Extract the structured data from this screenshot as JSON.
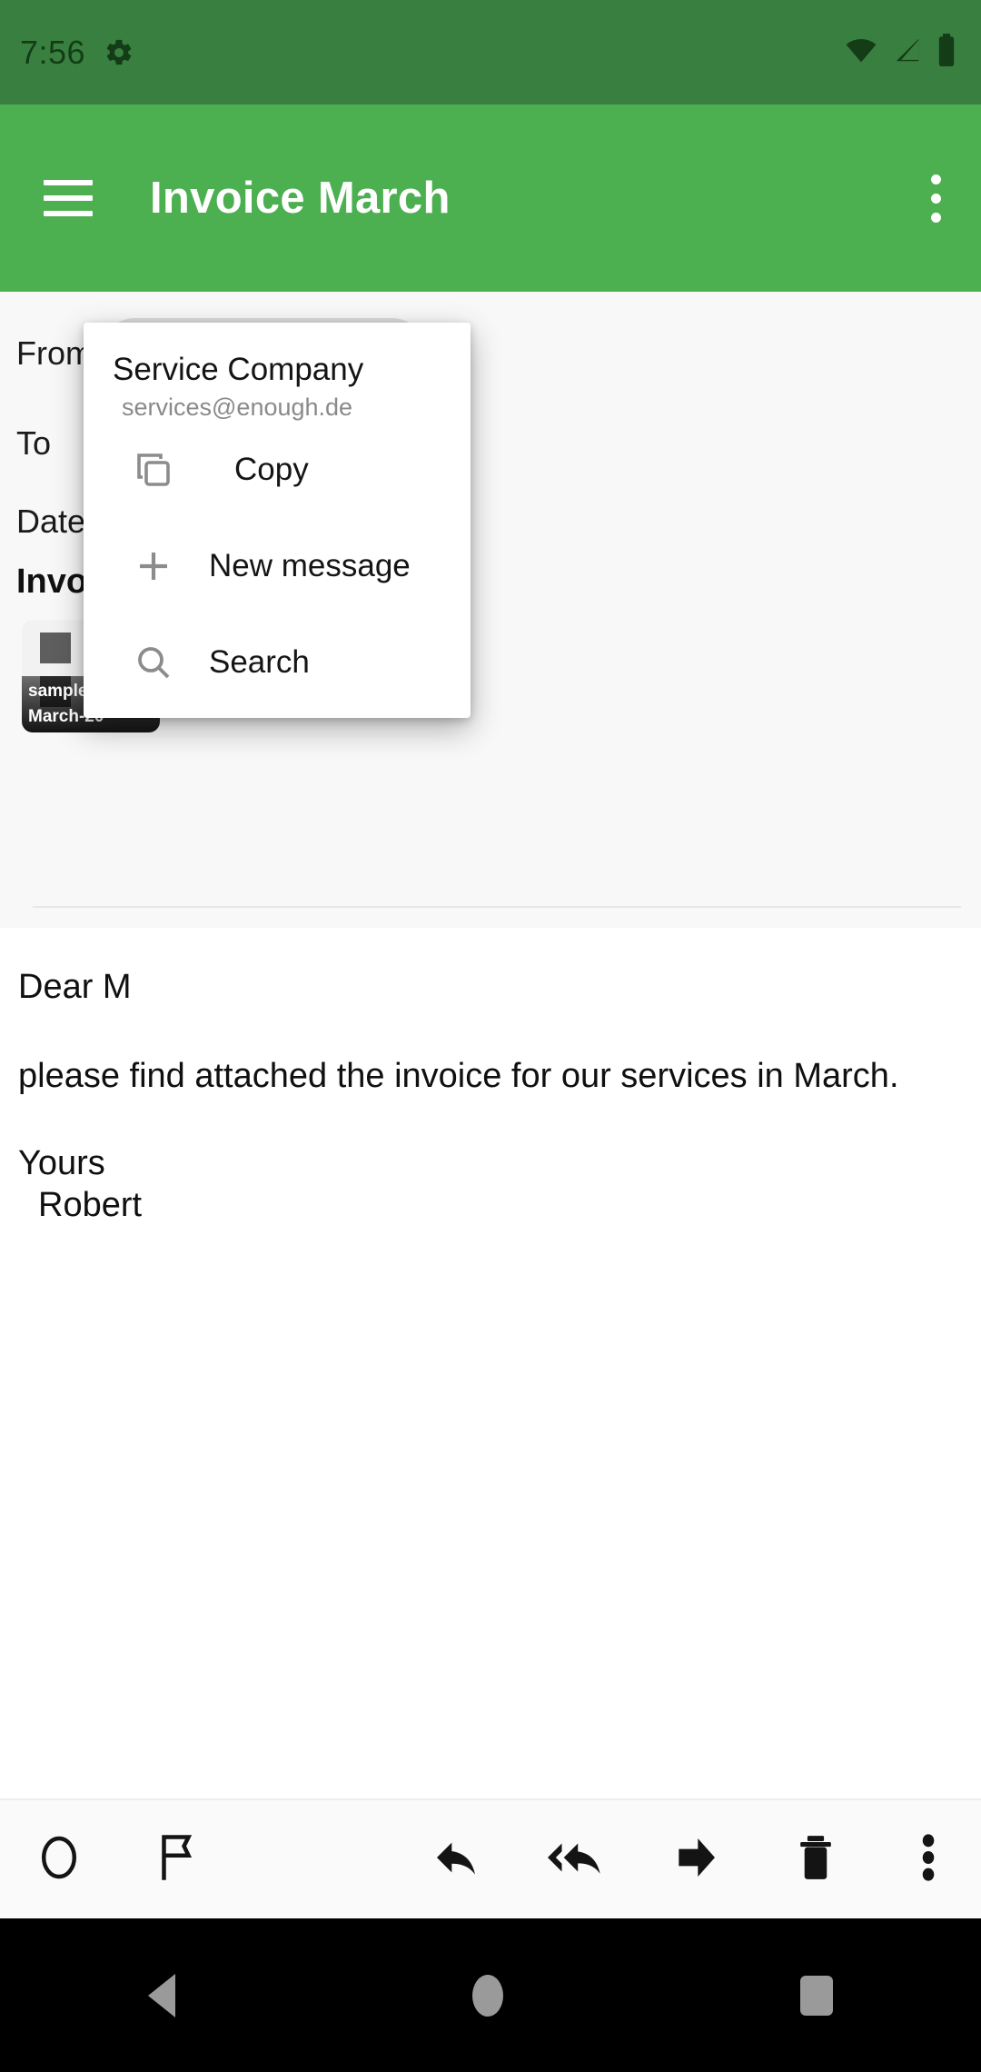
{
  "status_bar": {
    "time": "7:56",
    "icons": [
      "gear-icon",
      "wifi-icon",
      "signal-icon",
      "battery-icon"
    ],
    "background": "#398040"
  },
  "app_bar": {
    "title": "Invoice March",
    "menu_icon": "hamburger-icon",
    "overflow_icon": "overflow-menu-icon",
    "background": "#4caf50"
  },
  "message_headers": {
    "from_label": "From",
    "from_value": "Service Company",
    "to_label": "To",
    "to_value": "",
    "date_label": "Date",
    "date_value": "",
    "subject": "Invoice",
    "attachment": {
      "name_line1": "sample-in",
      "name_line2": "March-20"
    }
  },
  "body": {
    "greeting": "Dear M",
    "paragraph": "please find attached the invoice for our services in March.",
    "closing": "Yours",
    "signature": "Robert"
  },
  "popup": {
    "name": "Service Company",
    "email": "services@enough.de",
    "items": [
      {
        "label": "Copy",
        "icon": "copy-icon"
      },
      {
        "label": "New message",
        "icon": "plus-icon"
      },
      {
        "label": "Search",
        "icon": "search-icon"
      }
    ]
  },
  "toolbar": {
    "items": [
      {
        "name": "mark-unread-button",
        "icon": "circle-icon"
      },
      {
        "name": "flag-button",
        "icon": "flag-icon"
      },
      {
        "name": "reply-button",
        "icon": "reply-icon"
      },
      {
        "name": "reply-all-button",
        "icon": "reply-all-icon"
      },
      {
        "name": "forward-button",
        "icon": "forward-icon"
      },
      {
        "name": "delete-button",
        "icon": "trash-icon"
      },
      {
        "name": "more-button",
        "icon": "overflow-menu-icon"
      }
    ]
  },
  "nav_bar": {
    "back": "back-triangle-icon",
    "home": "home-circle-icon",
    "recents": "recents-square-icon"
  }
}
